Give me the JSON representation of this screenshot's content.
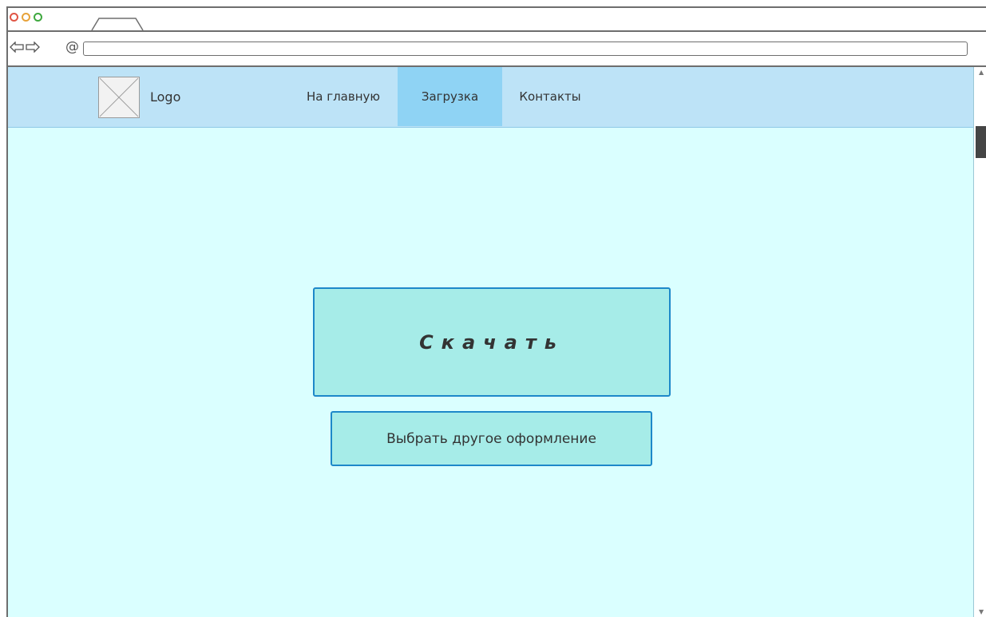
{
  "browser": {
    "url": "",
    "icons": {
      "close": "traffic-light-red",
      "minimize": "traffic-light-yellow",
      "maximize": "traffic-light-green",
      "back": "back-arrow-icon",
      "forward": "forward-arrow-icon",
      "address": "at-icon"
    },
    "at_symbol": "@"
  },
  "header": {
    "logo_label": "Logo",
    "nav": {
      "home": "На главную",
      "download": "Загрузка",
      "contacts": "Контакты"
    },
    "active_item": "download"
  },
  "main": {
    "download_button": "Скачать",
    "theme_button": "Выбрать другое оформление"
  },
  "colors": {
    "page_background": "#daffff",
    "navbar_background": "#bde3f7",
    "active_nav_background": "#8fd3f4",
    "button_background": "#a6ece8",
    "button_border": "#1d88c9"
  }
}
